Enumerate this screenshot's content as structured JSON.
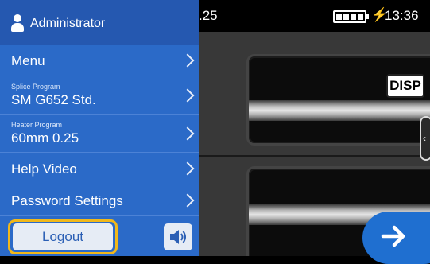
{
  "status": {
    "partial_value": ".25",
    "time": "13:36"
  },
  "panel": {
    "user": "Administrator",
    "menu_label": "Menu",
    "splice_program": {
      "caption": "Splice Program",
      "value": "SM G652 Std."
    },
    "heater_program": {
      "caption": "Heater Program",
      "value": "60mm 0.25"
    },
    "help_video_label": "Help Video",
    "password_settings_label": "Password Settings",
    "logout_label": "Logout"
  },
  "view": {
    "disp_label": "DISP"
  },
  "icons": {
    "user": "user-icon",
    "chevron": "chevron-right-icon",
    "sound": "speaker-icon",
    "battery": "battery-icon",
    "charging": "lightning-icon",
    "next": "arrow-right-icon"
  },
  "colors": {
    "panel_bg": "#2b6ac8",
    "highlight_ring": "#f1b81a",
    "next_button": "#1f6fd0"
  }
}
